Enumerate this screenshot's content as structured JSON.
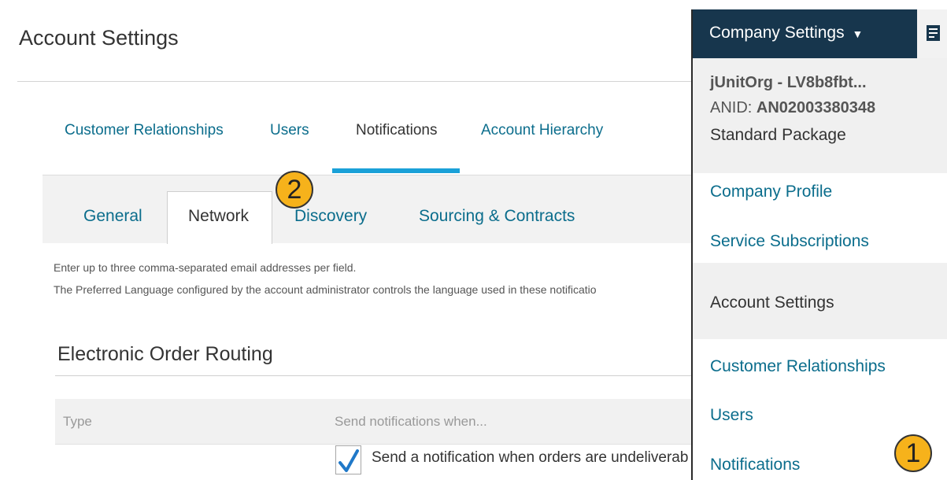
{
  "main": {
    "title": "Account Settings",
    "tabs": [
      {
        "label": "Customer Relationships"
      },
      {
        "label": "Users"
      },
      {
        "label": "Notifications"
      },
      {
        "label": "Account Hierarchy"
      }
    ],
    "subtabs": [
      {
        "label": "General"
      },
      {
        "label": "Network"
      },
      {
        "label": "Discovery"
      },
      {
        "label": "Sourcing & Contracts"
      }
    ],
    "info_lines": [
      "Enter up to three comma-separated email addresses per field.",
      "The Preferred Language configured by the account administrator controls the language used in these notificatio"
    ],
    "section_title": "Electronic Order Routing",
    "table": {
      "headers": [
        "Type",
        "Send notifications when..."
      ],
      "row_text": "Send a notification when orders are undeliverab",
      "row_checked": true
    }
  },
  "callouts": {
    "one": "1",
    "two": "2"
  },
  "panel": {
    "menu_label": "Company Settings",
    "org_name": "jUnitOrg - LV8b8fbt...",
    "anid_prefix": "ANID:",
    "anid_value": "AN02003380348",
    "package": "Standard Package",
    "links": [
      {
        "label": "Company Profile"
      },
      {
        "label": "Service Subscriptions"
      },
      {
        "label": "Account Settings"
      },
      {
        "label": "Customer Relationships"
      },
      {
        "label": "Users"
      },
      {
        "label": "Notifications"
      }
    ]
  },
  "colors": {
    "accent": "#1aa1d8",
    "link": "#0b6d8c",
    "header_bg": "#17364d",
    "callout": "#f6b21b"
  }
}
